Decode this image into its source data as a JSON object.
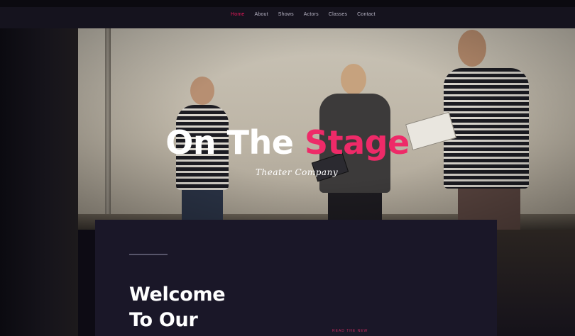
{
  "nav": {
    "items": [
      "Home",
      "About",
      "Shows",
      "Actors",
      "Classes",
      "Contact"
    ],
    "active_index": 0
  },
  "hero": {
    "title_white": "On The ",
    "title_pink": "Stage",
    "subtitle": "Theater Company"
  },
  "welcome": {
    "line1": "Welcome",
    "line2": "To Our",
    "tag": "READ THE NEW"
  },
  "colors": {
    "accent": "#ee2a68",
    "nav_bg": "#15131e",
    "card_bg": "#1a1728",
    "page_bg": "#0d0b14"
  },
  "icons": []
}
